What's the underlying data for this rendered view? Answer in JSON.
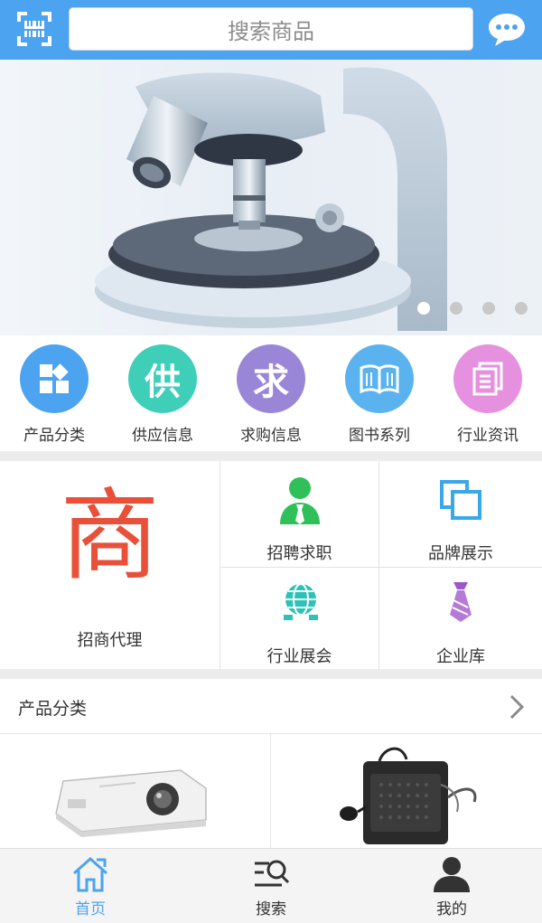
{
  "header": {
    "search_placeholder": "搜索商品",
    "scan_icon": "scan-icon",
    "chat_icon": "chat-icon",
    "color": "#4ca3f0"
  },
  "banner": {
    "image": "microscope-photo",
    "slide_count": 4,
    "active_slide": 1
  },
  "quick_links": [
    {
      "label": "产品分类",
      "icon": "grid-icon",
      "color": "#4ca3f0"
    },
    {
      "label": "供应信息",
      "icon": "supply-icon",
      "glyph": "供",
      "color": "#3fcfb8"
    },
    {
      "label": "求购信息",
      "icon": "purchase-icon",
      "glyph": "求",
      "color": "#9a86d6"
    },
    {
      "label": "图书系列",
      "icon": "book-icon",
      "color": "#5ab2ee"
    },
    {
      "label": "行业资讯",
      "icon": "news-icon",
      "color": "#e690e0"
    }
  ],
  "feature_grid": {
    "investment": {
      "label": "招商代理",
      "glyph": "商",
      "color": "#e8503a"
    },
    "recruit": {
      "label": "招聘求职",
      "icon": "person-icon"
    },
    "brand": {
      "label": "品牌展示",
      "icon": "overlap-squares-icon"
    },
    "expo": {
      "label": "行业展会",
      "icon": "globe-icon"
    },
    "company": {
      "label": "企业库",
      "icon": "tie-icon"
    }
  },
  "product_section": {
    "title": "产品分类",
    "items": [
      {
        "image": "projector"
      },
      {
        "image": "portable-speaker"
      }
    ]
  },
  "tabbar": {
    "tabs": [
      {
        "label": "首页",
        "icon": "home-icon",
        "active": true
      },
      {
        "label": "搜索",
        "icon": "search-list-icon",
        "active": false
      },
      {
        "label": "我的",
        "icon": "user-icon",
        "active": false
      }
    ]
  }
}
